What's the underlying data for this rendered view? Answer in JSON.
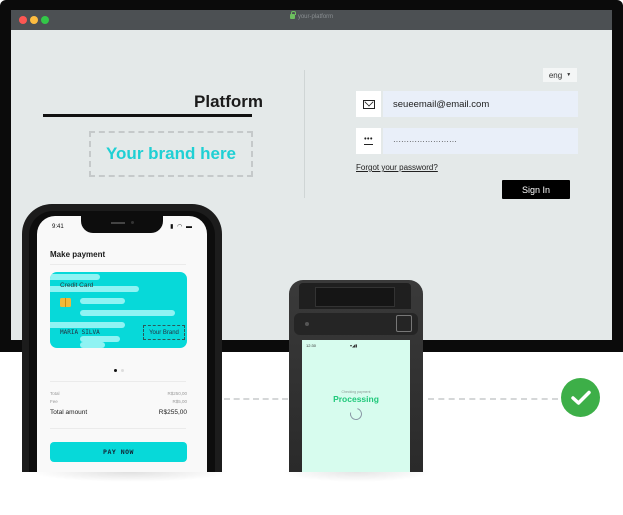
{
  "browser": {
    "url": "your-platform",
    "window_controls": [
      "close",
      "minimize",
      "maximize"
    ]
  },
  "login_page": {
    "platform_title": "Platform",
    "brand_placeholder": "Your brand here",
    "language": {
      "selected": "eng",
      "icon": "caret-down-icon"
    },
    "email_field": {
      "icon": "envelope-icon",
      "value": "seueemail@email.com"
    },
    "password_field": {
      "icon": "password-dots-icon",
      "value": "························"
    },
    "forgot_password_link": "Forgot your password?",
    "sign_in_button": "Sign In"
  },
  "phone": {
    "status_time": "9:41",
    "status_icons": "signal wifi battery",
    "title": "Make payment",
    "card": {
      "label": "Credit Card",
      "holder": "MARIA SILVA",
      "brand": "Your Brand"
    },
    "pager": {
      "count": 2,
      "active": 1
    },
    "summary": [
      {
        "label": "Total",
        "value": "R$250,00",
        "emphasis": false
      },
      {
        "label": "Fee",
        "value": "R$5,00",
        "emphasis": false
      },
      {
        "label": "Total amount",
        "value": "R$255,00",
        "emphasis": true
      }
    ],
    "pay_button": "PAY NOW"
  },
  "pos_terminal": {
    "status_time": "12:30",
    "status_icons": "wifi signal battery",
    "subtitle": "Checking payment",
    "title": "Processing"
  },
  "success_indicator": {
    "icon": "checkmark-icon",
    "color": "#3daf48"
  },
  "colors": {
    "brand_accent": "#1fd0d4",
    "card": "#07d9d9",
    "processing": "#1fc87a",
    "success": "#3daf48"
  }
}
